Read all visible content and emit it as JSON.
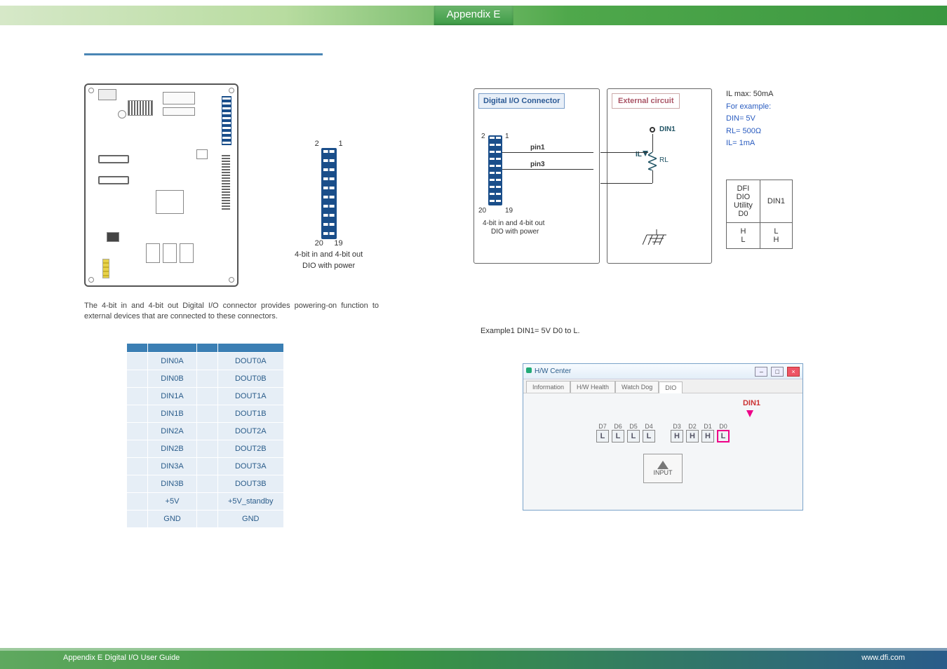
{
  "header": {
    "tab": "Appendix E"
  },
  "left": {
    "pin_diagram": {
      "top_left": "2",
      "top_right": "1",
      "bot_left": "20",
      "bot_right": "19",
      "caption1": "4-bit in and 4-bit out",
      "caption2": "DIO with power"
    },
    "description": "The 4-bit in and 4-bit out Digital I/O connector provides powering-on function to external devices that are connected to these connectors.",
    "table": {
      "headers": [
        "",
        "",
        "",
        ""
      ],
      "rows": [
        {
          "a_num": "",
          "a": "DIN0A",
          "b_num": "",
          "b": "DOUT0A"
        },
        {
          "a_num": "",
          "a": "DIN0B",
          "b_num": "",
          "b": "DOUT0B"
        },
        {
          "a_num": "",
          "a": "DIN1A",
          "b_num": "",
          "b": "DOUT1A"
        },
        {
          "a_num": "",
          "a": "DIN1B",
          "b_num": "",
          "b": "DOUT1B"
        },
        {
          "a_num": "",
          "a": "DIN2A",
          "b_num": "",
          "b": "DOUT2A"
        },
        {
          "a_num": "",
          "a": "DIN2B",
          "b_num": "",
          "b": "DOUT2B"
        },
        {
          "a_num": "",
          "a": "DIN3A",
          "b_num": "",
          "b": "DOUT3A"
        },
        {
          "a_num": "",
          "a": "DIN3B",
          "b_num": "",
          "b": "DOUT3B"
        },
        {
          "a_num": "",
          "a": "+5V",
          "b_num": "",
          "b": "+5V_standby"
        },
        {
          "a_num": "",
          "a": "GND",
          "b_num": "",
          "b": "GND"
        }
      ]
    }
  },
  "right": {
    "conn_title": "Digital I/O Connector",
    "ext_title": "External circuit",
    "pin1": "pin1",
    "pin3": "pin3",
    "mini": {
      "top_left": "2",
      "top_right": "1",
      "bot_left": "20",
      "bot_right": "19",
      "caption1": "4-bit in and 4-bit out",
      "caption2": "DIO with power"
    },
    "din1_node": "DIN1",
    "rl_label": "RL",
    "il_label": "IL",
    "spec": {
      "l1": "IL max: 50mA",
      "l2": "For example:",
      "l3": "DIN= 5V",
      "l4": "RL= 500Ω",
      "l5": "IL= 1mA"
    },
    "truth": {
      "h1": "DFI DIO Utility D0",
      "h2": "DIN1",
      "r1a": "H",
      "r1b": "L",
      "r2a": "L",
      "r2b": "H"
    },
    "example_caption": "Example1 DIN1= 5V D0 to L.",
    "hwcenter": {
      "title": "H/W Center",
      "tabs": [
        "Information",
        "H/W Health",
        "Watch Dog",
        "DIO"
      ],
      "active_tab": 3,
      "din1_label": "DIN1",
      "bits": [
        {
          "name": "D7",
          "val": "L",
          "hl": false
        },
        {
          "name": "D6",
          "val": "L",
          "hl": false
        },
        {
          "name": "D5",
          "val": "L",
          "hl": false
        },
        {
          "name": "D4",
          "val": "L",
          "hl": false
        },
        {
          "name": "D3",
          "val": "H",
          "hl": false
        },
        {
          "name": "D2",
          "val": "H",
          "hl": false
        },
        {
          "name": "D1",
          "val": "H",
          "hl": false
        },
        {
          "name": "D0",
          "val": "L",
          "hl": true
        }
      ],
      "input_btn": "INPUT"
    }
  },
  "footer": {
    "left": "Appendix E Digital I/O User Guide",
    "right": "www.dfi.com"
  }
}
